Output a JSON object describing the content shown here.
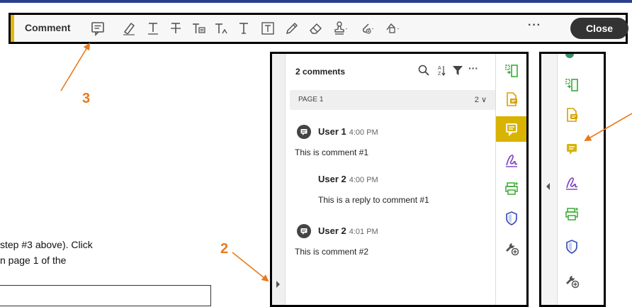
{
  "toolbar": {
    "title": "Comment",
    "more_label": "···",
    "close_label": "Close",
    "icons": [
      "sticky-note-icon",
      "highlight-icon",
      "underline-text-icon",
      "strikethrough-text-icon",
      "replace-text-icon",
      "insert-text-icon",
      "add-text-icon",
      "text-box-icon",
      "pencil-icon",
      "eraser-icon",
      "stamp-icon",
      "attach-icon",
      "shapes-icon"
    ]
  },
  "callouts": {
    "step3": "3",
    "step2": "2"
  },
  "instructions": {
    "line1": "step #3 above). Click",
    "line2": "n page 1 of the"
  },
  "comments_panel": {
    "header": "2 comments",
    "page_label": "PAGE 1",
    "page_count": "2 ∨",
    "comments": [
      {
        "user": "User 1",
        "time": "4:00 PM",
        "text": "This is comment #1"
      },
      {
        "user": "User 2",
        "time": "4:00 PM",
        "text": "This is a reply to comment #1"
      },
      {
        "user": "User 2",
        "time": "4:01 PM",
        "text": "This is comment #2"
      }
    ],
    "more_label": "···"
  },
  "colors": {
    "accent_yellow": "#d8b400",
    "callout_orange": "#e77a1c",
    "green_tool": "#3aaa35",
    "purple_tool": "#7b3fc1",
    "blue_tool": "#3b4fb8"
  }
}
